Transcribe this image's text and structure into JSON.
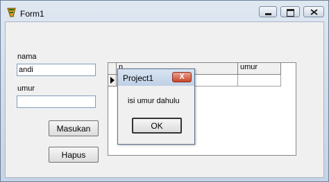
{
  "window": {
    "title": "Form1"
  },
  "form": {
    "nama_label": "nama",
    "nama_value": "andi",
    "umur_label": "umur",
    "umur_value": "",
    "masukan_label": "Masukan",
    "hapus_label": "Hapus"
  },
  "grid": {
    "headers": [
      "n",
      "umur"
    ]
  },
  "dialog": {
    "title": "Project1",
    "close_glyph": "X",
    "message": "isi umur dahulu",
    "ok_label": "OK"
  }
}
